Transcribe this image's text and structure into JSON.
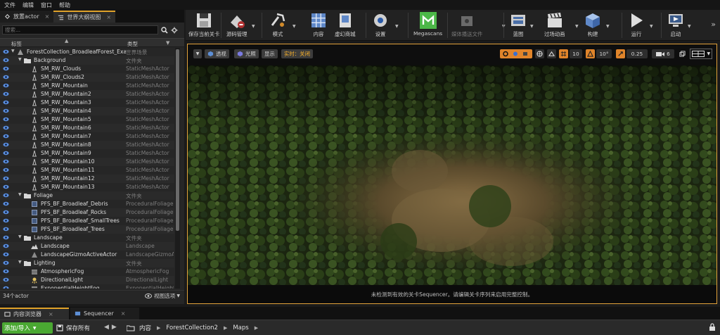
{
  "menu": [
    "文件",
    "编辑",
    "窗口",
    "帮助"
  ],
  "left_tabs": [
    {
      "label": "放置actor",
      "close": "×"
    },
    {
      "label": "世界大纲视图",
      "close": "×"
    }
  ],
  "outliner": {
    "search_placeholder": "搜索...",
    "col_label": "标签",
    "col_type": "类型",
    "rows": [
      {
        "label": "ForestCollection_BroadleafForest_Exar",
        "type": "世界场景",
        "indent": 0,
        "icon": "world-icon",
        "expander": "▼"
      },
      {
        "label": "Background",
        "type": "文件夹",
        "indent": 1,
        "icon": "folder-icon",
        "expander": "▼"
      },
      {
        "label": "SM_RW_Clouds",
        "type": "StaticMeshActor",
        "indent": 2,
        "icon": "static-mesh-icon"
      },
      {
        "label": "SM_RW_Clouds2",
        "type": "StaticMeshActor",
        "indent": 2,
        "icon": "static-mesh-icon"
      },
      {
        "label": "SM_RW_Mountain",
        "type": "StaticMeshActor",
        "indent": 2,
        "icon": "static-mesh-icon"
      },
      {
        "label": "SM_RW_Mountain2",
        "type": "StaticMeshActor",
        "indent": 2,
        "icon": "static-mesh-icon"
      },
      {
        "label": "SM_RW_Mountain3",
        "type": "StaticMeshActor",
        "indent": 2,
        "icon": "static-mesh-icon"
      },
      {
        "label": "SM_RW_Mountain4",
        "type": "StaticMeshActor",
        "indent": 2,
        "icon": "static-mesh-icon"
      },
      {
        "label": "SM_RW_Mountain5",
        "type": "StaticMeshActor",
        "indent": 2,
        "icon": "static-mesh-icon"
      },
      {
        "label": "SM_RW_Mountain6",
        "type": "StaticMeshActor",
        "indent": 2,
        "icon": "static-mesh-icon"
      },
      {
        "label": "SM_RW_Mountain7",
        "type": "StaticMeshActor",
        "indent": 2,
        "icon": "static-mesh-icon"
      },
      {
        "label": "SM_RW_Mountain8",
        "type": "StaticMeshActor",
        "indent": 2,
        "icon": "static-mesh-icon"
      },
      {
        "label": "SM_RW_Mountain9",
        "type": "StaticMeshActor",
        "indent": 2,
        "icon": "static-mesh-icon"
      },
      {
        "label": "SM_RW_Mountain10",
        "type": "StaticMeshActor",
        "indent": 2,
        "icon": "static-mesh-icon"
      },
      {
        "label": "SM_RW_Mountain11",
        "type": "StaticMeshActor",
        "indent": 2,
        "icon": "static-mesh-icon"
      },
      {
        "label": "SM_RW_Mountain12",
        "type": "StaticMeshActor",
        "indent": 2,
        "icon": "static-mesh-icon"
      },
      {
        "label": "SM_RW_Mountain13",
        "type": "StaticMeshActor",
        "indent": 2,
        "icon": "static-mesh-icon"
      },
      {
        "label": "Foliage",
        "type": "文件夹",
        "indent": 1,
        "icon": "folder-icon",
        "expander": "▼"
      },
      {
        "label": "PFS_BF_Broadleaf_Debris",
        "type": "ProceduralFoliage",
        "indent": 2,
        "icon": "procedural-foliage-icon"
      },
      {
        "label": "PFS_BF_Broadleaf_Rocks",
        "type": "ProceduralFoliage",
        "indent": 2,
        "icon": "procedural-foliage-icon"
      },
      {
        "label": "PFS_BF_Broadleaf_SmallTrees",
        "type": "ProceduralFoliage",
        "indent": 2,
        "icon": "procedural-foliage-icon"
      },
      {
        "label": "PFS_BF_Broadleaf_Trees",
        "type": "ProceduralFoliage",
        "indent": 2,
        "icon": "procedural-foliage-icon"
      },
      {
        "label": "Landscape",
        "type": "文件夹",
        "indent": 1,
        "icon": "folder-icon",
        "expander": "▼"
      },
      {
        "label": "Landscape",
        "type": "Landscape",
        "indent": 2,
        "icon": "landscape-icon"
      },
      {
        "label": "LandscapeGizmoActiveActor",
        "type": "LandscapeGizmoA",
        "indent": 2,
        "icon": "landscape-gizmo-icon"
      },
      {
        "label": "Lighting",
        "type": "文件夹",
        "indent": 1,
        "icon": "folder-icon",
        "expander": "▼"
      },
      {
        "label": "AtmosphericFog",
        "type": "AtmosphericFog",
        "indent": 2,
        "icon": "fog-icon"
      },
      {
        "label": "DirectionalLight",
        "type": "DirectionalLight",
        "indent": 2,
        "icon": "directional-light-icon"
      },
      {
        "label": "ExponentialHeightFog",
        "type": "ExponentialHeight",
        "indent": 2,
        "icon": "fog-icon"
      }
    ],
    "actor_count": "34个actor",
    "view_options": "视图选项"
  },
  "toolbar": {
    "buttons": [
      {
        "name": "save-current-level-button",
        "icon": "save-icon",
        "label": "保存当前关卡"
      },
      {
        "name": "source-control-button",
        "icon": "source-control-icon",
        "label": "源码管理"
      },
      {
        "name": "modes-button",
        "icon": "modes-icon",
        "label": "模式"
      },
      {
        "name": "content-button",
        "icon": "content-grid-icon",
        "label": "内容"
      },
      {
        "name": "marketplace-button",
        "icon": "marketplace-icon",
        "label": "虚幻商城"
      },
      {
        "name": "settings-button",
        "icon": "settings-icon",
        "label": "设置"
      },
      {
        "name": "megascans-button",
        "icon": "megascans-icon",
        "label": "Megascans"
      },
      {
        "name": "media-capture-button",
        "icon": "media-icon",
        "label": "媒体播送文件"
      },
      {
        "name": "blueprint-button",
        "icon": "blueprint-icon",
        "label": "蓝图"
      },
      {
        "name": "cinematics-button",
        "icon": "clapper-icon",
        "label": "过场动画"
      },
      {
        "name": "build-button",
        "icon": "build-icon",
        "label": "构建"
      },
      {
        "name": "play-button",
        "icon": "play-icon",
        "label": "运行"
      },
      {
        "name": "launch-button",
        "icon": "launch-icon",
        "label": "启动"
      }
    ],
    "more": "»"
  },
  "viewport": {
    "perspective": "透视",
    "lit": "光照",
    "show": "显示",
    "realtime": "实时：关闭",
    "grid_snap": "10",
    "rotation_snap": "10°",
    "scale_snap": "0.25",
    "camera_speed": "6",
    "status_message": "未检测到有效的关卡Sequencer。请编辑关卡序列来启用完整控制。"
  },
  "bottom_tabs": [
    {
      "label": "内容浏览器",
      "close": "×"
    },
    {
      "label": "Sequencer",
      "close": "×"
    }
  ],
  "content_bar": {
    "add_import": "添加/导入",
    "save_all": "保存所有",
    "breadcrumbs": [
      "内容",
      "ForestCollection2",
      "Maps"
    ]
  },
  "colors": {
    "accent": "#e0a22a",
    "add_button": "#4aa832",
    "selection_orange": "#e0842a"
  }
}
